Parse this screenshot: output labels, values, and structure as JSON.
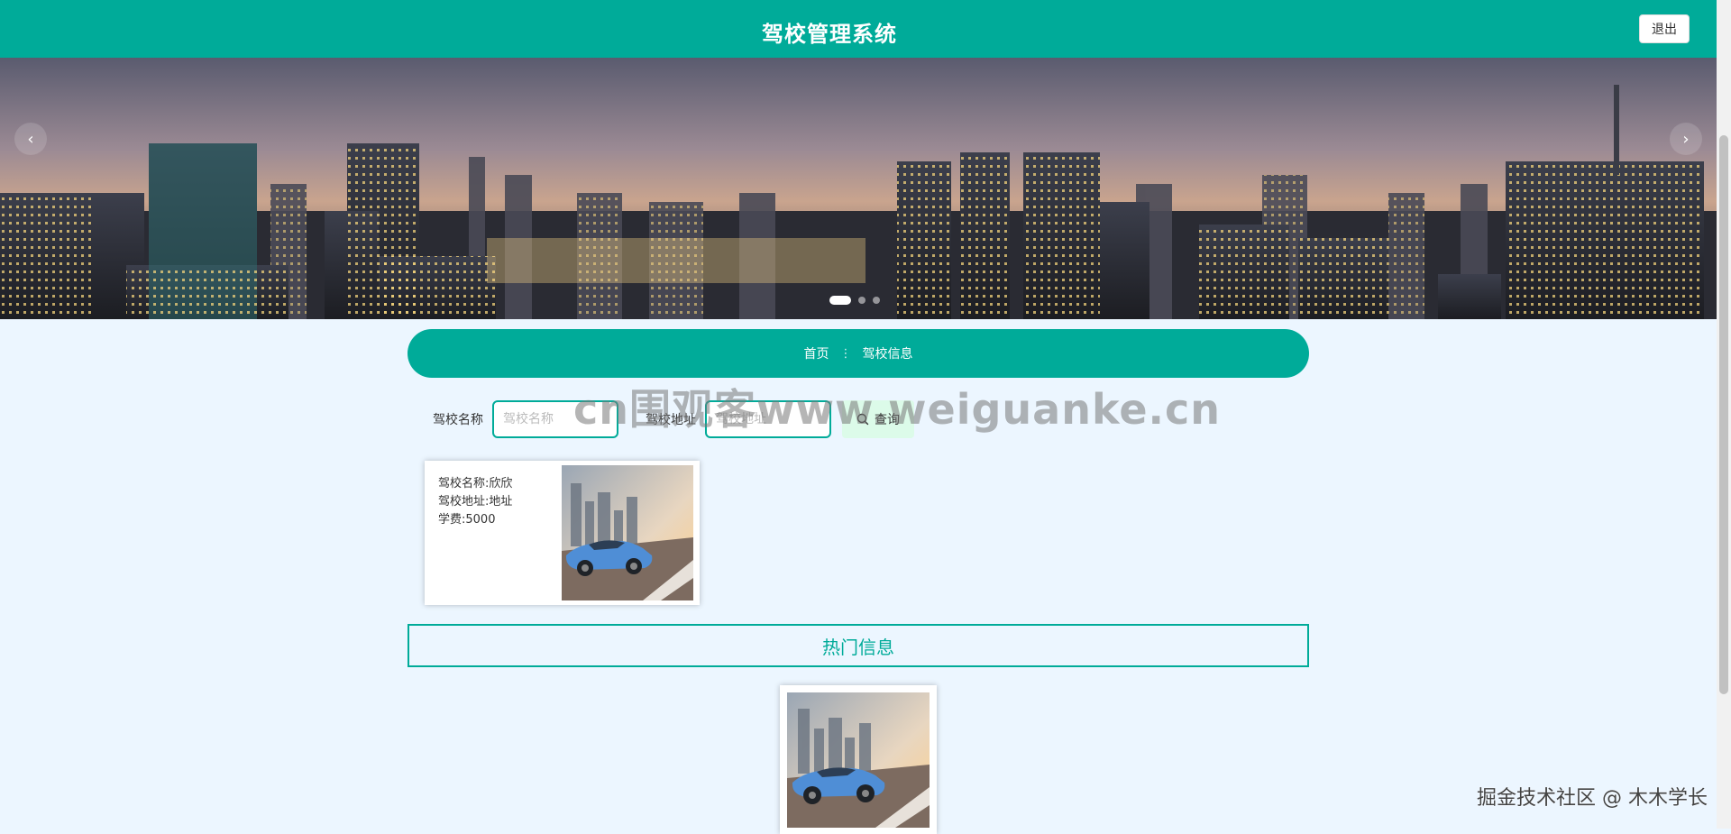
{
  "header": {
    "title": "驾校管理系统",
    "logout_label": "退出"
  },
  "banner": {
    "prev_icon": "‹",
    "next_icon": "›",
    "slide_count": 3,
    "active_slide": 1
  },
  "breadcrumb": {
    "home": "首页",
    "separator": "⋮",
    "current": "驾校信息"
  },
  "search": {
    "name_label": "驾校名称",
    "name_placeholder": "驾校名称",
    "address_label": "驾校地址",
    "address_placeholder": "驾校地址",
    "query_label": "查询",
    "query_icon": "search-icon"
  },
  "watermark": "cn围观客www.weiguanke.cn",
  "schools": [
    {
      "name_line": "驾校名称:欣欣",
      "address_line": "驾校地址:地址",
      "fee_line": "学费:5000"
    }
  ],
  "hot": {
    "title": "热门信息"
  },
  "footer_watermark": "掘金技术社区 @ 木木学长",
  "colors": {
    "primary": "#00ab99",
    "background": "#ecf6ff",
    "query_button": "#dcfbe9"
  }
}
